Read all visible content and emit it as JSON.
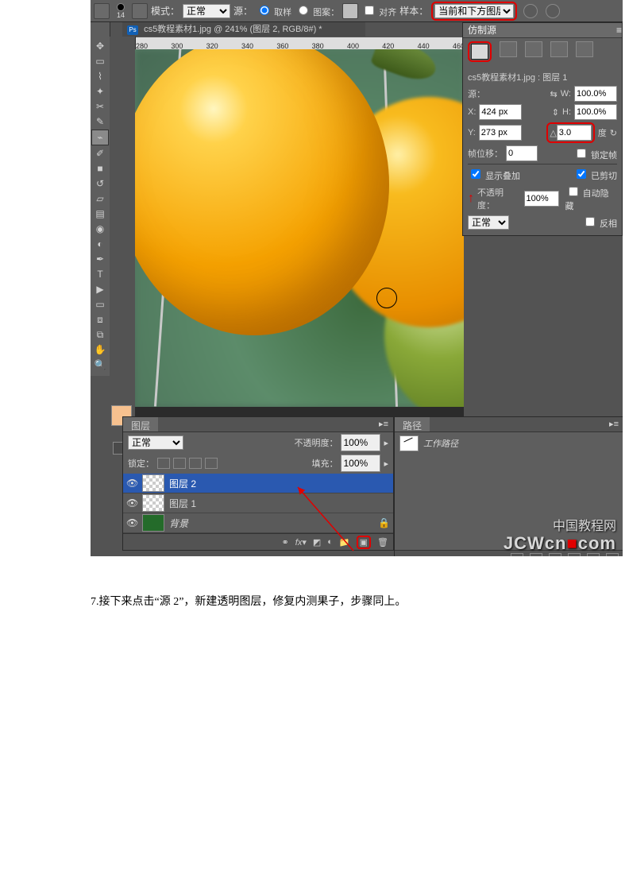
{
  "options_bar": {
    "brush_size": "14",
    "mode_label": "模式：",
    "mode_value": "正常",
    "source_label": "源：",
    "source_sample": "取样",
    "source_pattern": "图案：",
    "aligned": "对齐",
    "sample_label": "样本：",
    "sample_value": "当前和下方图层"
  },
  "document": {
    "title": "cs5教程素材1.jpg @ 241% (图层 2, RGB/8#) *"
  },
  "ruler": {
    "marks": [
      "280",
      "300",
      "320",
      "340",
      "360",
      "380",
      "400",
      "420",
      "440",
      "460"
    ]
  },
  "clone_source": {
    "title": "仿制源",
    "doc_line": "cs5教程素材1.jpg : 图层 1",
    "source_label": "源：",
    "w_label": "W:",
    "w_value": "100.0%",
    "x_label": "X:",
    "x_value": "424 px",
    "h_label": "H:",
    "h_value": "100.0%",
    "y_label": "Y:",
    "y_value": "273 px",
    "angle_value": "3.0",
    "degree_label": "度",
    "frame_offset_label": "帧位移：",
    "frame_offset_value": "0",
    "lock_frame": "锁定帧",
    "show_overlay": "显示叠加",
    "clipped": "已剪切",
    "opacity_label": "不透明度：",
    "opacity_value": "100%",
    "auto_hide": "自动隐藏",
    "overlay_mode": "正常",
    "invert": "反相"
  },
  "layers_panel": {
    "tab_label": "图层",
    "blend_mode": "正常",
    "opacity_label": "不透明度：",
    "opacity_value": "100%",
    "lock_label": "锁定：",
    "fill_label": "填充：",
    "fill_value": "100%",
    "layers": [
      {
        "name": "图层 2"
      },
      {
        "name": "图层 1"
      },
      {
        "name": "背景"
      }
    ]
  },
  "paths_panel": {
    "tab_label": "路径",
    "path_name": "工作路径"
  },
  "watermark": {
    "cn": "中国教程网",
    "en_1": "JCWcn",
    "dot": "■",
    "en_2": "com"
  },
  "tutorial": {
    "step_no": "7.",
    "step_text": "接下来点击“源 2”，新建透明图层，修复内测果子，步骤同上。"
  }
}
